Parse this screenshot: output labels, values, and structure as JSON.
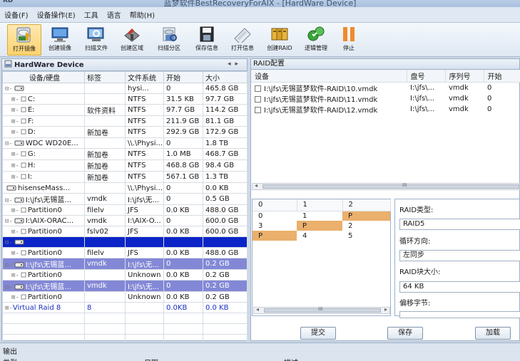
{
  "window": {
    "title": "蓝梦软件BestRecoveryForAIX - [HardWare Device]",
    "icon_text": "RD"
  },
  "menu": [
    "设备(F)",
    "设备操作(E)",
    "工具",
    "语言",
    "帮助(H)"
  ],
  "toolbar": [
    {
      "label": "打开镜像",
      "icon": "open-image-icon"
    },
    {
      "label": "创建镜像",
      "icon": "create-image-icon"
    },
    {
      "label": "扫描文件",
      "icon": "scan-files-icon"
    },
    {
      "label": "创建区域",
      "icon": "create-region-icon"
    },
    {
      "label": "扫描分区",
      "icon": "scan-partition-icon"
    },
    {
      "label": "保存信息",
      "icon": "save-info-icon"
    },
    {
      "label": "打开信息",
      "icon": "open-info-icon"
    },
    {
      "label": "创建RAID",
      "icon": "create-raid-icon"
    },
    {
      "label": "逻辑管理",
      "icon": "logic-manage-icon"
    },
    {
      "label": "停止",
      "icon": "stop-icon"
    }
  ],
  "left_panel": {
    "title": "HardWare Device",
    "columns": [
      "设备/硬盘",
      "标签",
      "文件系统",
      "开始",
      "大小"
    ],
    "rows": [
      {
        "tree": "⊟-",
        "name": "",
        "label": "",
        "fs": "hysi...",
        "start": "0",
        "size": "465.8 GB",
        "style": "",
        "icon": "disk"
      },
      {
        "tree": "⊞-",
        "name": "C:",
        "label": "",
        "fs": "NTFS",
        "start": "31.5 KB",
        "size": "97.7 GB",
        "style": "",
        "icon": "part",
        "indent": 1
      },
      {
        "tree": "⊞-",
        "name": "E:",
        "label": "软件资料",
        "fs": "NTFS",
        "start": "97.7 GB",
        "size": "114.2 GB",
        "style": "",
        "icon": "part",
        "indent": 1
      },
      {
        "tree": "⊞-",
        "name": "F:",
        "label": "",
        "fs": "NTFS",
        "start": "211.9 GB",
        "size": "81.1 GB",
        "style": "",
        "icon": "part",
        "indent": 1
      },
      {
        "tree": "⊞-",
        "name": "D:",
        "label": "新加卷",
        "fs": "NTFS",
        "start": "292.9 GB",
        "size": "172.9 GB",
        "style": "",
        "icon": "part",
        "indent": 1
      },
      {
        "tree": "⊟-",
        "name": "WDC WD20E...",
        "label": "",
        "fs": "\\\\.\\Physi...",
        "start": "0",
        "size": "1.8 TB",
        "style": "",
        "icon": "disk"
      },
      {
        "tree": "⊞-",
        "name": "G:",
        "label": "新加卷",
        "fs": "NTFS",
        "start": "1.0 MB",
        "size": "468.7 GB",
        "style": "",
        "icon": "part",
        "indent": 1
      },
      {
        "tree": "⊞-",
        "name": "H:",
        "label": "新加卷",
        "fs": "NTFS",
        "start": "468.8 GB",
        "size": "98.4 GB",
        "style": "",
        "icon": "part",
        "indent": 1
      },
      {
        "tree": "⊞-",
        "name": "I:",
        "label": "新加卷",
        "fs": "NTFS",
        "start": "567.1 GB",
        "size": "1.3 TB",
        "style": "",
        "icon": "part",
        "indent": 1
      },
      {
        "tree": "",
        "name": "hisenseMass...",
        "label": "",
        "fs": "\\\\.\\Physi...",
        "start": "0",
        "size": "0.0 KB",
        "style": "",
        "icon": "disk"
      },
      {
        "tree": "⊟-",
        "name": "I:\\jfs\\无锡蓝...",
        "label": "vmdk",
        "fs": "I:\\jfs\\无...",
        "start": "0",
        "size": "0.5 GB",
        "style": "",
        "icon": "disk"
      },
      {
        "tree": "⊞-",
        "name": "Partition0",
        "label": "filelv",
        "fs": "JFS",
        "start": "0.0 KB",
        "size": "488.0 GB",
        "style": "",
        "icon": "part",
        "indent": 1
      },
      {
        "tree": "⊟-",
        "name": "I:\\AIX-ORAC...",
        "label": "vmdk",
        "fs": "I:\\AIX-O...",
        "start": "0",
        "size": "600.0 GB",
        "style": "",
        "icon": "disk"
      },
      {
        "tree": "⊞-",
        "name": "Partition0",
        "label": "fslv02",
        "fs": "JFS",
        "start": "0.0 KB",
        "size": "600.0 GB",
        "style": "",
        "icon": "part",
        "indent": 1
      },
      {
        "tree": "⊟-",
        "name": "",
        "label": "",
        "fs": "",
        "start": "",
        "size": "",
        "style": "sel-dark",
        "icon": "disk"
      },
      {
        "tree": "⊞-",
        "name": "Partition0",
        "label": "filelv",
        "fs": "JFS",
        "start": "0.0 KB",
        "size": "488.0 GB",
        "style": "",
        "icon": "part",
        "indent": 1
      },
      {
        "tree": "⊟-",
        "name": "I:\\jfs\\无锡蓝...",
        "label": "vmdk",
        "fs": "I:\\jfs\\无...",
        "start": "0",
        "size": "0.2 GB",
        "style": "sel",
        "icon": "disk"
      },
      {
        "tree": "⊞-",
        "name": "Partition0",
        "label": "",
        "fs": "Unknown",
        "start": "0.0 KB",
        "size": "0.2 GB",
        "style": "",
        "icon": "part",
        "indent": 1
      },
      {
        "tree": "⊟-",
        "name": "I:\\jfs\\无锡蓝...",
        "label": "vmdk",
        "fs": "I:\\jfs\\无...",
        "start": "0",
        "size": "0.2 GB",
        "style": "sel",
        "icon": "disk"
      },
      {
        "tree": "⊞-",
        "name": "Partition0",
        "label": "",
        "fs": "Unknown",
        "start": "0.0 KB",
        "size": "0.2 GB",
        "style": "",
        "icon": "part",
        "indent": 1
      },
      {
        "tree": "⊞-",
        "name": "Virtual Raid 8",
        "label": "8",
        "fs": "",
        "start": "0.0KB",
        "size": "0.0 KB",
        "style": "virt",
        "icon": "none"
      },
      {
        "tree": "",
        "name": "",
        "label": "",
        "fs": "",
        "start": "",
        "size": "",
        "style": "",
        "icon": "none"
      },
      {
        "tree": "",
        "name": "",
        "label": "",
        "fs": "",
        "start": "",
        "size": "",
        "style": "",
        "icon": "none"
      },
      {
        "tree": "",
        "name": "",
        "label": "",
        "fs": "",
        "start": "",
        "size": "",
        "style": "",
        "icon": "none"
      }
    ]
  },
  "raid_panel": {
    "title": "RAID配置",
    "columns": [
      "设备",
      "盘号",
      "序列号",
      "开始"
    ],
    "rows": [
      {
        "device": "I:\\jfs\\无锡蓝梦软件-RAID\\10.vmdk",
        "disk": "I:\\jfs\\...",
        "serial": "vmdk",
        "start": "0"
      },
      {
        "device": "I:\\jfs\\无锡蓝梦软件-RAID\\11.vmdk",
        "disk": "I:\\jfs\\...",
        "serial": "vmdk",
        "start": "0"
      },
      {
        "device": "I:\\jfs\\无锡蓝梦软件-RAID\\12.vmdk",
        "disk": "I:\\jfs\\...",
        "serial": "vmdk",
        "start": "0"
      }
    ],
    "scroll_mid": "III"
  },
  "parity_grid": {
    "columns": [
      "0",
      "1",
      "2"
    ],
    "rows": [
      [
        "0",
        "1",
        "P"
      ],
      [
        "3",
        "P",
        "2"
      ],
      [
        "P",
        "4",
        "5"
      ]
    ],
    "scroll_mid": "III"
  },
  "params": {
    "raid_type_label": "RAID类型:",
    "raid_type_value": "RAID5",
    "direction_label": "循环方向:",
    "direction_value": "左同步",
    "block_label": "RAID块大小:",
    "block_value": "64 KB",
    "offset_label": "偏移字节:"
  },
  "buttons": {
    "submit": "提交",
    "save": "保存",
    "load": "加载"
  },
  "output": {
    "title": "输出",
    "col_type": "类型",
    "col_date": "日期",
    "col_desc": "描述"
  }
}
